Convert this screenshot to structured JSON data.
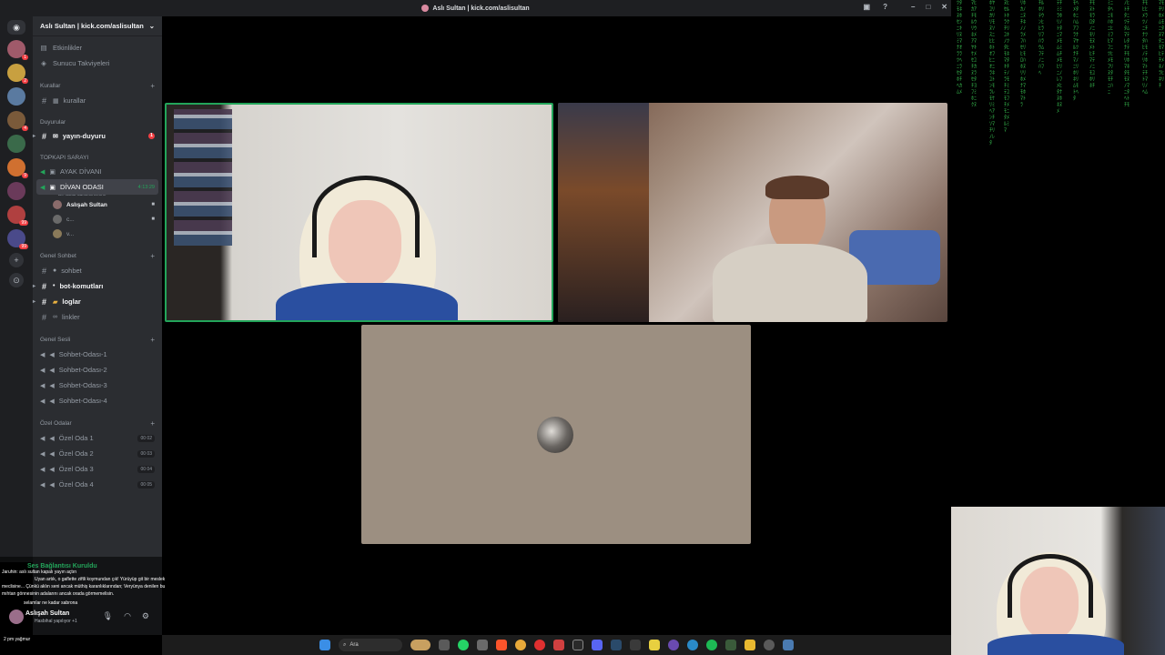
{
  "window": {
    "title": "Aslı Sultan | kick.com/aslisultan"
  },
  "server": {
    "name": "Aslı Sultan | kick.com/aslisultan"
  },
  "top_items": [
    {
      "label": "Etkinlikler",
      "icon": "calendar-icon"
    },
    {
      "label": "Sunucu Takviyeleri",
      "icon": "boost-icon"
    }
  ],
  "categories": {
    "kurallar": "Kurallar",
    "duyurular": "Duyurular",
    "topkapi": "TOPKAPI SARAYI",
    "genel_sohbet": "Genel Sohbet",
    "genel_sesli": "Genel Sesli",
    "ozel_odalar": "Özel Odalar"
  },
  "channels": {
    "kurallar": "kurallar",
    "yayin_duyuru": "yayın-duyuru",
    "yayin_duyuru_badge": "1",
    "ayak_divani": "AYAK DİVANI",
    "divan_odasi": "DİVAN ODASI",
    "divan_time": "4:13:29",
    "divan_sub": "Bir kanal durumu belirle",
    "sohbet": "sohbet",
    "bot_komutlari": "bot-komutları",
    "loglar": "loglar",
    "linkler": "linkler",
    "sesli": [
      "Sohbet-Odası-1",
      "Sohbet-Odası-2",
      "Sohbet-Odası-3",
      "Sohbet-Odası-4"
    ],
    "ozel": [
      {
        "label": "Özel Oda 1",
        "count": "00 02"
      },
      {
        "label": "Özel Oda 2",
        "count": "00 03"
      },
      {
        "label": "Özel Oda 3",
        "count": "00 04"
      },
      {
        "label": "Özel Oda 4",
        "count": "00 05"
      }
    ]
  },
  "voice_members": [
    "Aslışah Sultan",
    "c...",
    "v..."
  ],
  "user_panel": {
    "connection": "Ses Bağlantısı Kuruldu",
    "chat_lines": [
      "Jaruhin: aslı sultan kapalı yayın açtın",
      "Uyan artık, o gaflette ziftli koymundan çık! Yürüyüp git bir meslek",
      "meclisine... Çünkü aklın seni ancak müthiş karanlıklarından; Veryünya denilen bu",
      "mıhtan gönnesinin adalarını ancak orada görmemelisin.",
      "selamlar ne kadar sabrona"
    ],
    "username": "Aslışah Sultan",
    "status": "Hasbihal yapılıyor +1",
    "bottom_chat": "2 pm yağmur"
  },
  "taskbar": {
    "search_placeholder": "Ara"
  },
  "matrix_columns": [
    "ﾂﾀﾓﾈﾇﾎｾﾝﾆｷﾘﾇﾐﾏﾅｵﾗﾗﾂﾍﾆﾗｾﾀﾎﾁﾍｶﾑﾒ",
    "ﾏﾋｶｱﾁﾓﾙｳﾘｳﾈﾒｱﾏﾔｷｹﾒｾﾕﾁｶﾇﾗｾﾀﾁﾖﾌﾐﾎﾆｸﾇ",
    "ﾎﾔﾕﾘｶﾘﾘﾓﾇｿｽﾆﾋﾋﾎﾄｵﾌﾋﾆｵﾆﾗﾈﾕﾄﾝﾓﾗﾚﾓｹﾘﾐﾍｱﾝﾁｿﾏﾁﾘﾉﾚﾀ",
    "ﾇﾋｾﾙﾄｷﾗｸﾁﾘﾕｷﾉﾂﾀﾋﾓﾈﾏﾀｷﾁﾃﾉﾗﾓﾁﾐﾃﾕﾓﾌﾁﾒﾓﾆﾀﾒﾙﾐﾏ",
    "ﾘﾎｶﾉﾆﾇﾁﾈﾉﾉﾗﾒﾌﾊｾﾘﾋﾓﾛﾊﾎﾇﾘﾘﾎﾒﾅﾏﾓﾎﾏﾄﾗ",
    "ﾁﾙﾎﾘﾃｳﾝﾋﾋﾗﾘﾌﾊﾗｳﾑﾌﾃﾉﾆﾊﾌﾍ",
    "ﾃﾁﾐﾐﾗﾎﾘﾉﾄﾀﾆﾏﾒﾓﾑﾐﾑﾁﾒﾓﾋﾘﾆﾉﾚﾌﾒﾋﾀﾅﾇﾎﾈﾇﾒ",
    "ﾓﾍﾒﾀﾎﾆﾊﾑｱﾌﾗﾅﾏﾔﾙﾂﾅﾁﾏﾉﾆﾘﾎﾘﾈﾘﾑﾓﾄﾍﾀ",
    "ﾁﾓﾇﾄﾓﾗﾛﾀﾉﾆﾓﾘﾓﾇﾒﾄﾋﾁﾏﾃﾉﾆﾓﾕﾎﾘﾈﾁ",
    "ﾐﾆﾀﾍﾆﾓﾊﾎﾆﾋﾐﾌﾋﾏﾌﾆﾂﾋﾒﾓﾌﾘﾇﾀﾓﾁﾆﾊﾆ",
    "ﾉﾋﾄﾁﾀﾆﾂﾃﾀﾑﾏﾃﾚﾀﾅﾃﾁﾓﾘﾎﾏﾈﾀﾓﾓﾇﾉﾏﾆﾀﾍﾄﾁﾓ",
    "ﾁﾓﾋﾋﾒﾗﾂﾉﾆﾁﾅﾂﾀﾊﾋﾓﾉﾃﾘﾎﾏﾄﾃﾁﾄﾏﾘﾉﾍﾑ",
    "ﾏﾓﾁﾘﾎﾒﾑﾓﾆﾀﾇﾏﾀﾆﾓﾏﾋﾃﾁﾒﾈﾉﾗﾋﾈﾘﾁ"
  ]
}
